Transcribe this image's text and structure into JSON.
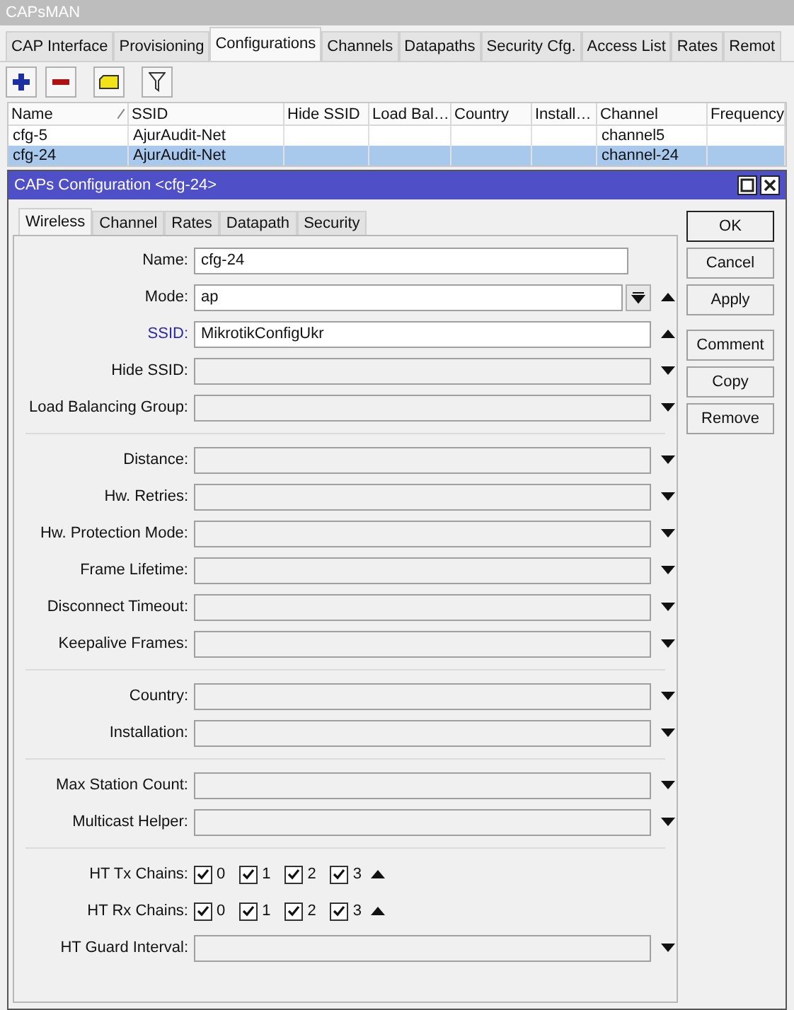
{
  "window": {
    "title": "CAPsMAN"
  },
  "tabs": [
    {
      "label": "CAP Interface",
      "selected": false
    },
    {
      "label": "Provisioning",
      "selected": false
    },
    {
      "label": "Configurations",
      "selected": true
    },
    {
      "label": "Channels",
      "selected": false
    },
    {
      "label": "Datapaths",
      "selected": false
    },
    {
      "label": "Security Cfg.",
      "selected": false
    },
    {
      "label": "Access List",
      "selected": false
    },
    {
      "label": "Rates",
      "selected": false
    },
    {
      "label": "Remot",
      "selected": false
    }
  ],
  "table": {
    "columns": [
      "Name",
      "SSID",
      "Hide SSID",
      "Load Bal…",
      "Country",
      "Install…",
      "Channel",
      "Frequency"
    ],
    "rows": [
      {
        "selected": false,
        "cells": [
          "cfg-5",
          "AjurAudit-Net",
          "",
          "",
          "",
          "",
          "channel5",
          ""
        ]
      },
      {
        "selected": true,
        "cells": [
          "cfg-24",
          "AjurAudit-Net",
          "",
          "",
          "",
          "",
          "channel-24",
          ""
        ]
      }
    ]
  },
  "dialog": {
    "title": "CAPs Configuration <cfg-24>",
    "tabs": [
      {
        "label": "Wireless",
        "selected": true
      },
      {
        "label": "Channel",
        "selected": false
      },
      {
        "label": "Rates",
        "selected": false
      },
      {
        "label": "Datapath",
        "selected": false
      },
      {
        "label": "Security",
        "selected": false
      }
    ],
    "groups": [
      [
        {
          "label": "Name:",
          "kind": "text",
          "value": "cfg-24",
          "highlighted": false
        },
        {
          "label": "Mode:",
          "kind": "combo",
          "value": "ap",
          "highlighted": false
        },
        {
          "label": "SSID:",
          "kind": "text-expanded",
          "value": "MikrotikConfigUkr",
          "highlighted": true
        },
        {
          "label": "Hide SSID:",
          "kind": "dropdown",
          "highlighted": false
        },
        {
          "label": "Load Balancing Group:",
          "kind": "dropdown",
          "highlighted": false
        }
      ],
      [
        {
          "label": "Distance:",
          "kind": "dropdown",
          "highlighted": false
        },
        {
          "label": "Hw. Retries:",
          "kind": "dropdown",
          "highlighted": false
        },
        {
          "label": "Hw. Protection Mode:",
          "kind": "dropdown",
          "highlighted": false
        },
        {
          "label": "Frame Lifetime:",
          "kind": "dropdown",
          "highlighted": false
        },
        {
          "label": "Disconnect Timeout:",
          "kind": "dropdown",
          "highlighted": false
        },
        {
          "label": "Keepalive Frames:",
          "kind": "dropdown",
          "highlighted": false
        }
      ],
      [
        {
          "label": "Country:",
          "kind": "dropdown",
          "highlighted": false
        },
        {
          "label": "Installation:",
          "kind": "dropdown",
          "highlighted": false
        }
      ],
      [
        {
          "label": "Max Station Count:",
          "kind": "dropdown",
          "highlighted": false
        },
        {
          "label": "Multicast Helper:",
          "kind": "dropdown",
          "highlighted": false
        }
      ],
      [
        {
          "label": "HT Tx Chains:",
          "kind": "checks",
          "highlighted": false,
          "options": [
            {
              "label": "0",
              "checked": true
            },
            {
              "label": "1",
              "checked": true
            },
            {
              "label": "2",
              "checked": true
            },
            {
              "label": "3",
              "checked": true
            }
          ]
        },
        {
          "label": "HT Rx Chains:",
          "kind": "checks",
          "highlighted": false,
          "options": [
            {
              "label": "0",
              "checked": true
            },
            {
              "label": "1",
              "checked": true
            },
            {
              "label": "2",
              "checked": true
            },
            {
              "label": "3",
              "checked": true
            }
          ]
        },
        {
          "label": "HT Guard Interval:",
          "kind": "dropdown",
          "highlighted": false
        }
      ]
    ],
    "buttons": [
      [
        "OK",
        "Cancel",
        "Apply"
      ],
      [
        "Comment",
        "Copy",
        "Remove"
      ]
    ]
  }
}
